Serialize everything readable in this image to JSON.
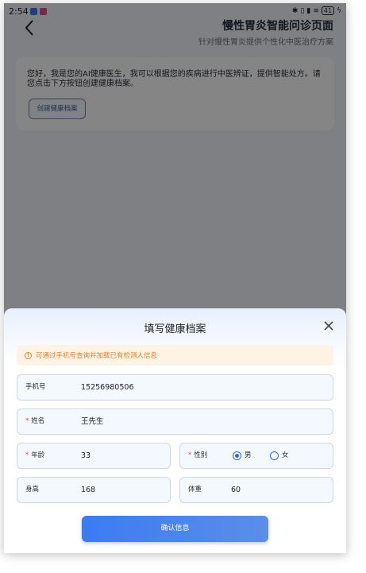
{
  "status_bar": {
    "time": "2:54",
    "battery": "41"
  },
  "header": {
    "title": "慢性胃炎智能问诊页面",
    "subtitle": "针对慢性胃炎提供个性化中医治疗方案"
  },
  "intro": {
    "text": "您好，我是您的AI健康医生，我可以根据您的疾病进行中医辨证，提供智能处方。请您点击下方按钮创建健康档案。",
    "button_label": "创建健康档案"
  },
  "sheet": {
    "title": "填写健康档案",
    "notice": "可通过手机号查询并加载已有检测人信息",
    "fields": {
      "phone": {
        "label": "手机号",
        "value": "15256980506"
      },
      "name": {
        "label": "姓名",
        "value": "王先生"
      },
      "age": {
        "label": "年龄",
        "value": "33"
      },
      "gender": {
        "label": "性别",
        "options": [
          "男",
          "女"
        ],
        "selected": "男"
      },
      "height": {
        "label": "身高",
        "value": "168"
      },
      "weight": {
        "label": "体重",
        "value": "60"
      }
    },
    "confirm_label": "确认信息"
  },
  "colors": {
    "accent": "#3b7bf3",
    "notice": "#e2812a",
    "required": "#e54545"
  }
}
